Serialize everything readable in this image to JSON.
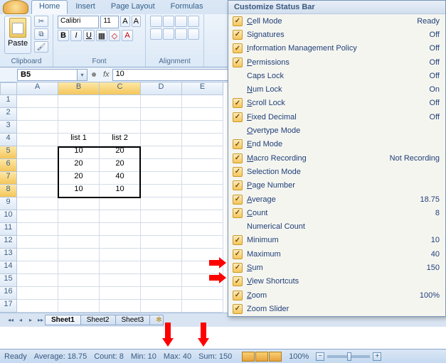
{
  "ribbon": {
    "tabs": [
      "Home",
      "Insert",
      "Page Layout",
      "Formulas"
    ],
    "active_tab": "Home",
    "paste_label": "Paste",
    "group_clipboard": "Clipboard",
    "group_font": "Font",
    "group_alignment": "Alignment",
    "font_name": "Calibri",
    "font_size": "11"
  },
  "namebox": "B5",
  "formula": "10",
  "columns": [
    "A",
    "B",
    "C",
    "D",
    "E"
  ],
  "rows": [
    "1",
    "2",
    "3",
    "4",
    "5",
    "6",
    "7",
    "8",
    "9",
    "10",
    "11",
    "12",
    "13",
    "14",
    "15",
    "16",
    "17"
  ],
  "data": {
    "B4": "list 1",
    "C4": "list 2",
    "B5": "10",
    "C5": "20",
    "B6": "20",
    "C6": "20",
    "B7": "20",
    "C7": "40",
    "B8": "10",
    "C8": "10"
  },
  "selection": {
    "top_row": 5,
    "bottom_row": 8,
    "left_col": "B",
    "right_col": "C"
  },
  "sheet_tabs": [
    "Sheet1",
    "Sheet2",
    "Sheet3"
  ],
  "active_sheet": "Sheet1",
  "statusbar": {
    "mode": "Ready",
    "average_label": "Average:",
    "average": "18.75",
    "count_label": "Count:",
    "count": "8",
    "min_label": "Min:",
    "min": "10",
    "max_label": "Max:",
    "max": "40",
    "sum_label": "Sum:",
    "sum": "150",
    "zoom": "100%"
  },
  "ctxmenu": {
    "title": "Customize Status Bar",
    "items": [
      {
        "checked": true,
        "label": "Cell Mode",
        "u": "C",
        "value": "Ready"
      },
      {
        "checked": true,
        "label": "Signatures",
        "u": "",
        "value": "Off"
      },
      {
        "checked": true,
        "label": "Information Management Policy",
        "u": "I",
        "value": "Off"
      },
      {
        "checked": true,
        "label": "Permissions",
        "u": "P",
        "value": "Off"
      },
      {
        "checked": false,
        "label": "Caps Lock",
        "u": "",
        "value": "Off"
      },
      {
        "checked": false,
        "label": "Num Lock",
        "u": "N",
        "value": "On"
      },
      {
        "checked": true,
        "label": "Scroll Lock",
        "u": "S",
        "value": "Off"
      },
      {
        "checked": true,
        "label": "Fixed Decimal",
        "u": "F",
        "value": "Off"
      },
      {
        "checked": false,
        "label": "Overtype Mode",
        "u": "O",
        "value": ""
      },
      {
        "checked": true,
        "label": "End Mode",
        "u": "E",
        "value": ""
      },
      {
        "checked": true,
        "label": "Macro Recording",
        "u": "M",
        "value": "Not Recording"
      },
      {
        "checked": true,
        "label": "Selection Mode",
        "u": "",
        "value": ""
      },
      {
        "checked": true,
        "label": "Page Number",
        "u": "P",
        "value": ""
      },
      {
        "checked": true,
        "label": "Average",
        "u": "A",
        "value": "18.75"
      },
      {
        "checked": true,
        "label": "Count",
        "u": "C",
        "value": "8"
      },
      {
        "checked": false,
        "label": "Numerical Count",
        "u": "",
        "value": ""
      },
      {
        "checked": true,
        "label": "Minimum",
        "u": "",
        "value": "10"
      },
      {
        "checked": true,
        "label": "Maximum",
        "u": "",
        "value": "40"
      },
      {
        "checked": true,
        "label": "Sum",
        "u": "S",
        "value": "150"
      },
      {
        "checked": true,
        "label": "View Shortcuts",
        "u": "V",
        "value": ""
      },
      {
        "checked": true,
        "label": "Zoom",
        "u": "Z",
        "value": "100%"
      },
      {
        "checked": true,
        "label": "Zoom Slider",
        "u": "",
        "value": ""
      }
    ]
  },
  "chart_data": {
    "type": "table",
    "columns": [
      "list 1",
      "list 2"
    ],
    "rows": [
      [
        10,
        20
      ],
      [
        20,
        20
      ],
      [
        20,
        40
      ],
      [
        10,
        10
      ]
    ],
    "stats": {
      "average": 18.75,
      "count": 8,
      "min": 10,
      "max": 40,
      "sum": 150
    }
  }
}
